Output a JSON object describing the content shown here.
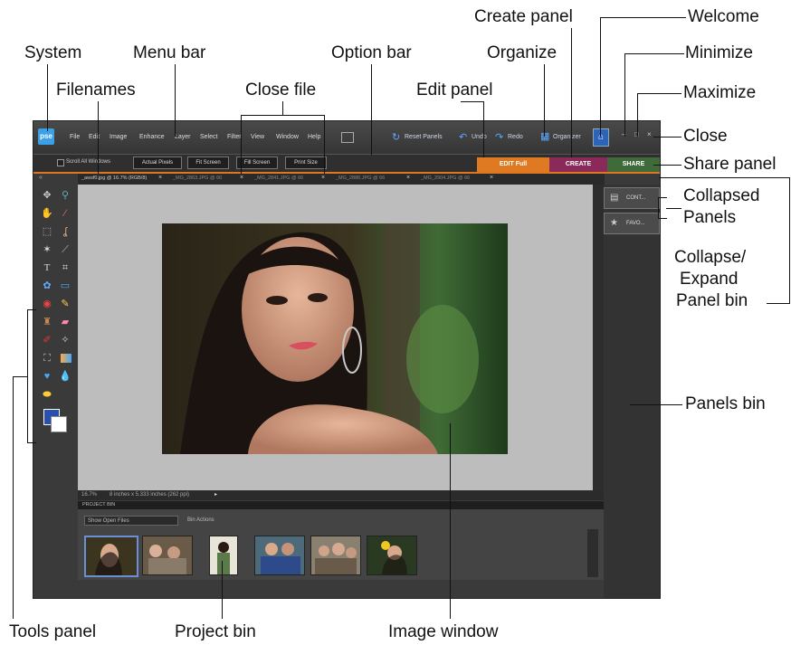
{
  "callouts": {
    "system": "System",
    "menu_bar": "Menu bar",
    "filenames": "Filenames",
    "close_file": "Close file",
    "option_bar": "Option bar",
    "edit_panel": "Edit panel",
    "organize": "Organize",
    "create_panel": "Create panel",
    "welcome": "Welcome",
    "minimize": "Minimize",
    "maximize": "Maximize",
    "close": "Close",
    "share_panel": "Share panel",
    "collapsed_panels_1": "Collapsed",
    "collapsed_panels_2": "Panels",
    "collapse_expand_1": "Collapse/",
    "collapse_expand_2": "Expand",
    "collapse_expand_3": "Panel bin",
    "panels_bin": "Panels bin",
    "tools_panel": "Tools panel",
    "project_bin": "Project bin",
    "image_window": "Image window"
  },
  "app": {
    "logo": "pse",
    "menu": [
      "File",
      "Edit",
      "Image",
      "Enhance",
      "Layer",
      "Select",
      "Filter",
      "View",
      "Window",
      "Help"
    ],
    "reset_panels": "Reset Panels",
    "undo": "Undo",
    "redo": "Redo",
    "organizer": "Organizer",
    "options": {
      "scroll_all": "Scroll All Windows",
      "actual_pixels": "Actual Pixels",
      "fit_screen": "Fit Screen",
      "fill_screen": "Fill Screen",
      "print_size": "Print Size"
    },
    "panel_tabs": {
      "edit": "EDIT Full",
      "create": "CREATE",
      "share": "SHARE"
    },
    "file_tabs": [
      "_awsf0.jpg @ 16.7% (RGB/8)",
      "_MG_2863.JPG @ 66",
      "_MG_2841.JPG @ 66",
      "_MG_2886.JPG @ 66",
      "_MG_2904.JPG @ 66"
    ],
    "status": {
      "zoom": "16.7%",
      "size": "8 inches x 5.333 inches (262 ppi)"
    },
    "project_bin": {
      "title": "PROJECT BIN",
      "show": "Show Open Files",
      "bin_actions": "Bin Actions"
    },
    "collapsed_panels": [
      "CONT...",
      "FAVO..."
    ]
  },
  "colors": {
    "edit": "#e07a22",
    "create": "#8a2a5a",
    "share": "#3f6b3a",
    "accent": "#e0761f"
  }
}
